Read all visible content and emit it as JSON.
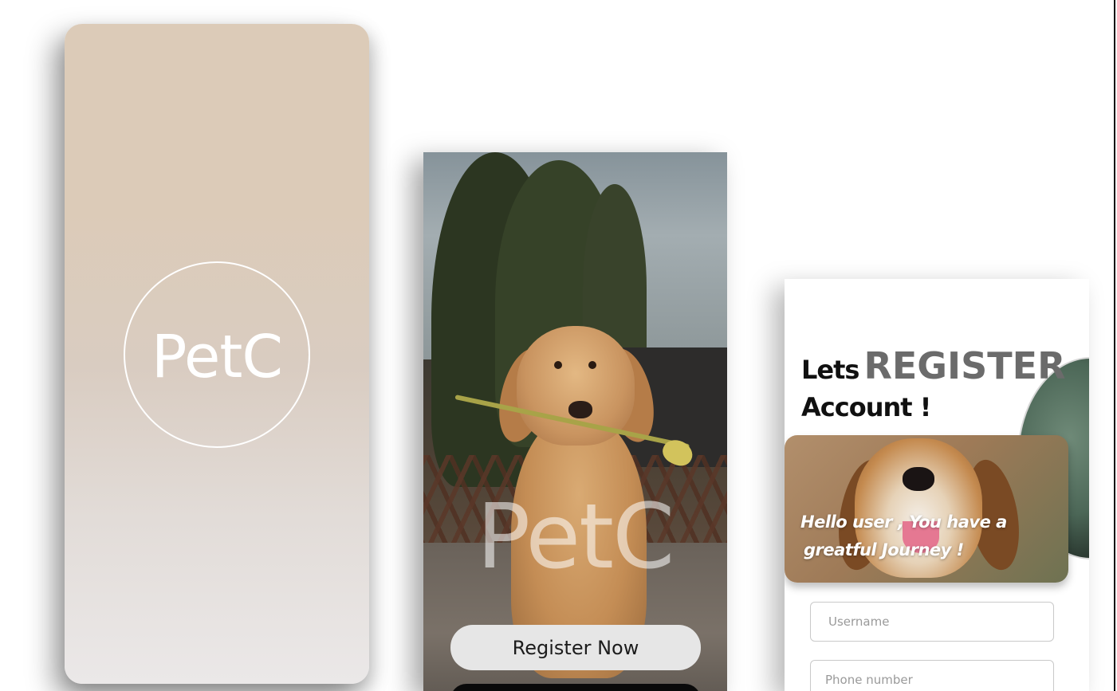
{
  "splash": {
    "logo": "PetC",
    "colors": {
      "top": "#dccbb8",
      "bottom": "#ebe8e8",
      "ring": "#ffffff"
    }
  },
  "welcome": {
    "logo": "PetC",
    "register_button": "Register Now"
  },
  "register": {
    "title_lets": "Lets",
    "title_register": "REGISTER",
    "title_account": "Account !",
    "greeting_line1": "Hello user , You have a",
    "greeting_line2": "greatful Journey !",
    "fields": {
      "username_placeholder": "Username",
      "phone_placeholder": "Phone number"
    },
    "colors": {
      "title_dark": "#101010",
      "title_grey": "#6b6b6b"
    }
  }
}
